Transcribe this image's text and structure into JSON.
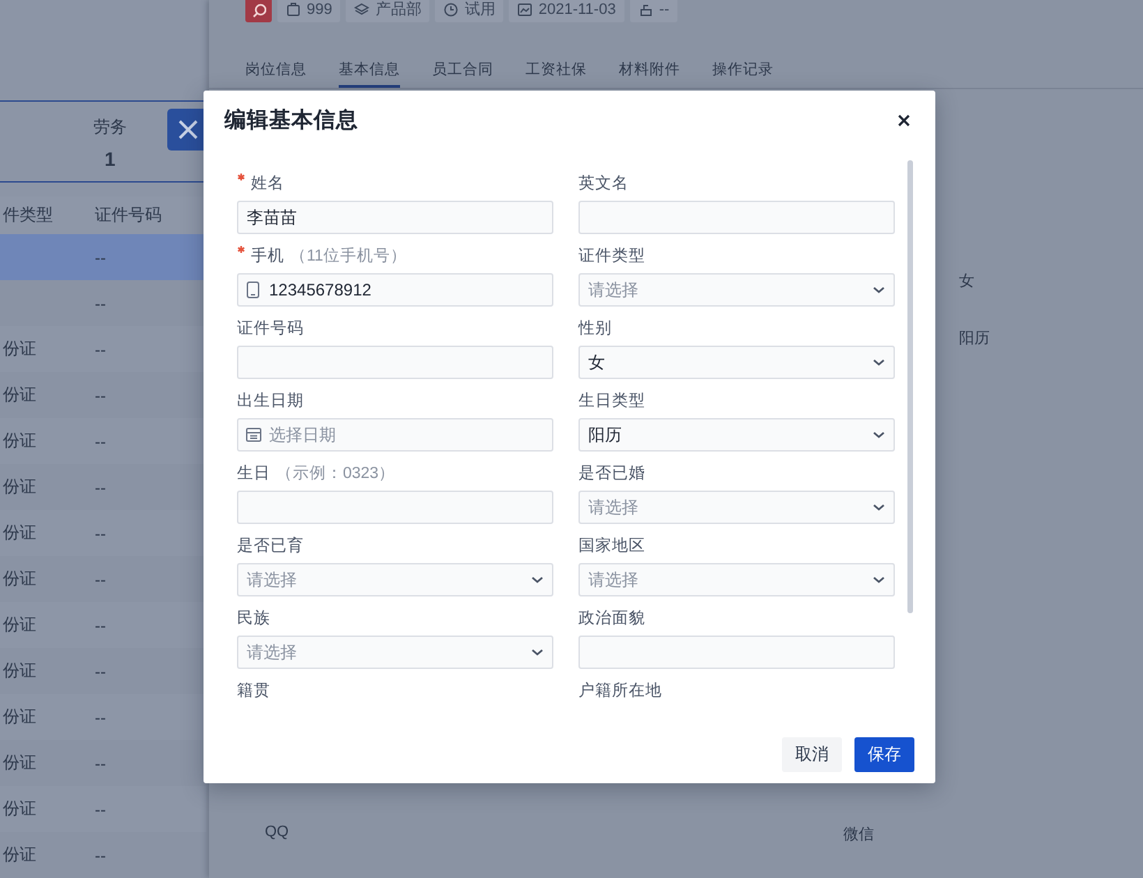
{
  "left_panel": {
    "stats": [
      {
        "label": "劳务",
        "value": "1"
      }
    ],
    "table": {
      "columns": [
        "件类型",
        "证件号码"
      ],
      "rows": [
        {
          "cells": [
            "",
            "--"
          ],
          "selected": true
        },
        {
          "cells": [
            "",
            "--"
          ],
          "selected": false
        },
        {
          "cells": [
            "份证",
            "--"
          ],
          "selected": false
        },
        {
          "cells": [
            "份证",
            "--"
          ],
          "selected": false
        },
        {
          "cells": [
            "份证",
            "--"
          ],
          "selected": false
        },
        {
          "cells": [
            "份证",
            "--"
          ],
          "selected": false
        },
        {
          "cells": [
            "份证",
            "--"
          ],
          "selected": false
        },
        {
          "cells": [
            "份证",
            "--"
          ],
          "selected": false
        },
        {
          "cells": [
            "份证",
            "--"
          ],
          "selected": false
        },
        {
          "cells": [
            "份证",
            "--"
          ],
          "selected": false
        },
        {
          "cells": [
            "份证",
            "--"
          ],
          "selected": false
        },
        {
          "cells": [
            "份证",
            "--"
          ],
          "selected": false
        },
        {
          "cells": [
            "份证",
            "--"
          ],
          "selected": false
        },
        {
          "cells": [
            "份证",
            "--"
          ],
          "selected": false
        }
      ]
    }
  },
  "employee": {
    "tags": [
      {
        "kind": "flag"
      },
      {
        "kind": "id",
        "text": "999"
      },
      {
        "kind": "department",
        "text": "产品部"
      },
      {
        "kind": "status",
        "text": "试用"
      },
      {
        "kind": "date",
        "text": "2021-11-03"
      },
      {
        "kind": "other",
        "text": "--"
      }
    ],
    "tabs": [
      {
        "label": "岗位信息",
        "selected": false
      },
      {
        "label": "基本信息",
        "selected": true
      },
      {
        "label": "员工合同",
        "selected": false
      },
      {
        "label": "工资社保",
        "selected": false
      },
      {
        "label": "材料附件",
        "selected": false
      },
      {
        "label": "操作记录",
        "selected": false
      }
    ],
    "details": [
      "女",
      "阳历",
      "QQ",
      "微信"
    ]
  },
  "dialog": {
    "title": "编辑基本信息",
    "fields": [
      {
        "label": "姓名",
        "required": true,
        "kind": "text",
        "value": "李苗苗"
      },
      {
        "label": "英文名",
        "required": false,
        "kind": "text"
      },
      {
        "label": "手机",
        "required": true,
        "hint": "（11位手机号）",
        "kind": "phone",
        "value": "12345678912"
      },
      {
        "label": "证件类型",
        "required": false,
        "kind": "select",
        "placeholder": "请选择"
      },
      {
        "label": "证件号码",
        "required": false,
        "kind": "text"
      },
      {
        "label": "性别",
        "required": false,
        "kind": "select",
        "value": "女"
      },
      {
        "label": "出生日期",
        "required": false,
        "kind": "date",
        "placeholder": "选择日期"
      },
      {
        "label": "生日类型",
        "required": false,
        "kind": "select",
        "value": "阳历"
      },
      {
        "label": "生日",
        "required": false,
        "hint": "（示例：0323）",
        "kind": "text"
      },
      {
        "label": "是否已婚",
        "required": false,
        "kind": "select",
        "placeholder": "请选择"
      },
      {
        "label": "是否已育",
        "required": false,
        "kind": "select",
        "placeholder": "请选择"
      },
      {
        "label": "国家地区",
        "required": false,
        "kind": "select",
        "placeholder": "请选择"
      },
      {
        "label": "民族",
        "required": false,
        "kind": "select",
        "placeholder": "请选择"
      },
      {
        "label": "政治面貌",
        "required": false,
        "kind": "text"
      },
      {
        "label": "籍贯",
        "required": false,
        "kind": "label"
      },
      {
        "label": "户籍所在地",
        "required": false,
        "kind": "label"
      }
    ],
    "buttons": [
      {
        "label": "取消",
        "kind": "secondary"
      },
      {
        "label": "保存",
        "kind": "primary"
      }
    ]
  }
}
